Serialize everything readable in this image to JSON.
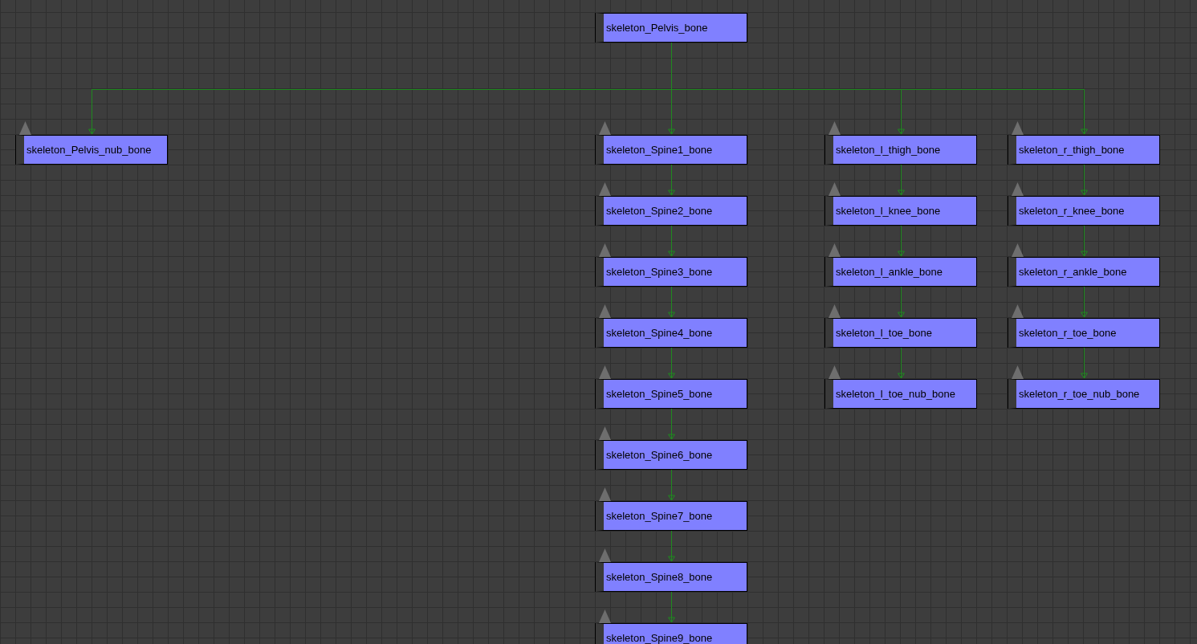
{
  "graph": {
    "root": {
      "name": "skeleton_Pelvis_bone",
      "children": [
        {
          "name": "skeleton_Pelvis_nub_bone"
        },
        {
          "name": "skeleton_Spine1_bone",
          "children": [
            {
              "name": "skeleton_Spine2_bone",
              "children": [
                {
                  "name": "skeleton_Spine3_bone",
                  "children": [
                    {
                      "name": "skeleton_Spine4_bone",
                      "children": [
                        {
                          "name": "skeleton_Spine5_bone",
                          "children": [
                            {
                              "name": "skeleton_Spine6_bone",
                              "children": [
                                {
                                  "name": "skeleton_Spine7_bone",
                                  "children": [
                                    {
                                      "name": "skeleton_Spine8_bone",
                                      "children": [
                                        {
                                          "name": "skeleton_Spine9_bone"
                                        }
                                      ]
                                    }
                                  ]
                                }
                              ]
                            }
                          ]
                        }
                      ]
                    }
                  ]
                }
              ]
            }
          ]
        },
        {
          "name": "skeleton_l_thigh_bone",
          "children": [
            {
              "name": "skeleton_l_knee_bone",
              "children": [
                {
                  "name": "skeleton_l_ankle_bone",
                  "children": [
                    {
                      "name": "skeleton_l_toe_bone",
                      "children": [
                        {
                          "name": "skeleton_l_toe_nub_bone"
                        }
                      ]
                    }
                  ]
                }
              ]
            }
          ]
        },
        {
          "name": "skeleton_r_thigh_bone",
          "children": [
            {
              "name": "skeleton_r_knee_bone",
              "children": [
                {
                  "name": "skeleton_r_ankle_bone",
                  "children": [
                    {
                      "name": "skeleton_r_toe_bone",
                      "children": [
                        {
                          "name": "skeleton_r_toe_nub_bone"
                        }
                      ]
                    }
                  ]
                }
              ]
            }
          ]
        }
      ]
    }
  }
}
